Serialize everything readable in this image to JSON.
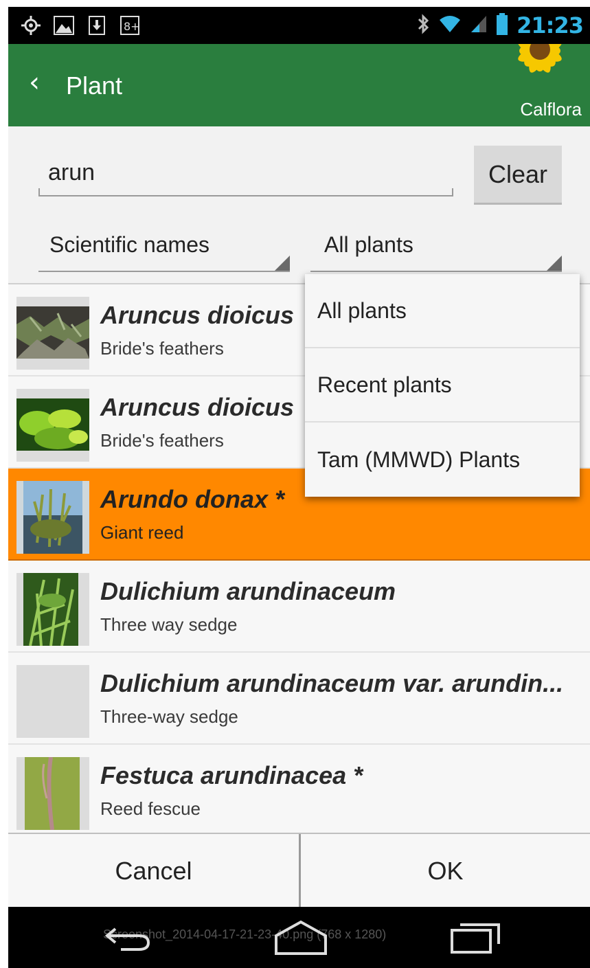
{
  "status_bar": {
    "time": "21:23",
    "icons": [
      "gps-icon",
      "image-icon",
      "download-icon",
      "google-plus-icon",
      "bluetooth-icon",
      "wifi-icon",
      "signal-icon",
      "battery-icon"
    ]
  },
  "app_bar": {
    "back_glyph": "‹",
    "title": "Plant",
    "brand": "Calflora"
  },
  "search": {
    "value": "arun",
    "clear_label": "Clear"
  },
  "filters": {
    "name_type": "Scientific names",
    "plant_list": "All plants"
  },
  "dropdown": {
    "options": [
      "All plants",
      "Recent plants",
      "Tam (MMWD) Plants"
    ]
  },
  "results": [
    {
      "scientific": "Aruncus dioicus",
      "common": "Bride's feathers",
      "thumb": "dark-foliage"
    },
    {
      "scientific": "Aruncus dioicus",
      "common": "Bride's feathers",
      "thumb": "green-leaves"
    },
    {
      "scientific": "Arundo donax *",
      "common": "Giant reed",
      "thumb": "reeds-water",
      "selected": true
    },
    {
      "scientific": "Dulichium arundinaceum",
      "common": "Three way sedge",
      "thumb": "grass"
    },
    {
      "scientific": "Dulichium arundinaceum var. arundin...",
      "common": "Three-way sedge",
      "thumb": "none"
    },
    {
      "scientific": "Festuca arundinacea *",
      "common": "Reed fescue",
      "thumb": "fescue"
    }
  ],
  "buttons": {
    "cancel": "Cancel",
    "ok": "OK"
  },
  "nav_bar": {
    "caption": "Screenshot_2014-04-17-21-23-40.png (768 x 1280)"
  },
  "colors": {
    "app_bar": "#2a7e3e",
    "selected_row": "#ff8800",
    "clock": "#33b5e5"
  }
}
